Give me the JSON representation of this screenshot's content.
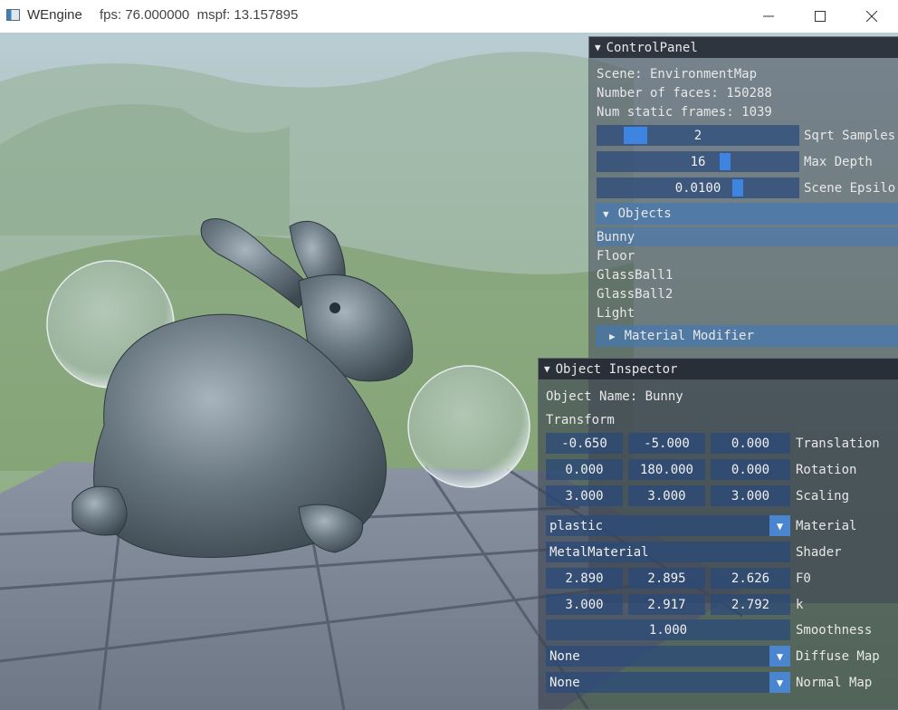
{
  "window": {
    "title": "WEngine",
    "stats": "fps: 76.000000  mspf: 13.157895",
    "minimize": "—",
    "maximize": "☐",
    "close": "✕"
  },
  "colors": {
    "accent": "#3d85e0",
    "frame_bg": "#294a7a",
    "header": "#4278b9"
  },
  "control_panel": {
    "title": "ControlPanel",
    "scene": "Scene: EnvironmentMap",
    "faces": "Number of faces: 150288",
    "static_frames": "Num static frames: 1039",
    "sqrt_samples": {
      "value": "2",
      "label": "Sqrt Samples"
    },
    "max_depth": {
      "value": "16",
      "label": "Max Depth"
    },
    "scene_epsilon": {
      "value": "0.0100",
      "label": "Scene Epsilo"
    },
    "objects_header": "Objects",
    "objects": [
      "Bunny",
      "Floor",
      "GlassBall1",
      "GlassBall2",
      "Light"
    ],
    "selected_object": "Bunny",
    "material_modifier": "Material Modifier"
  },
  "object_inspector": {
    "title": "Object Inspector",
    "object_name": "Object Name: Bunny",
    "transform_label": "Transform",
    "translation": {
      "values": [
        "-0.650",
        "-5.000",
        "0.000"
      ],
      "label": "Translation"
    },
    "rotation": {
      "values": [
        "0.000",
        "180.000",
        "0.000"
      ],
      "label": "Rotation"
    },
    "scaling": {
      "values": [
        "3.000",
        "3.000",
        "3.000"
      ],
      "label": "Scaling"
    },
    "material": {
      "value": "plastic",
      "label": "Material"
    },
    "shader": {
      "value": "MetalMaterial",
      "label": "Shader"
    },
    "f0": {
      "values": [
        "2.890",
        "2.895",
        "2.626"
      ],
      "label": "F0"
    },
    "k": {
      "values": [
        "3.000",
        "2.917",
        "2.792"
      ],
      "label": "k"
    },
    "smoothness": {
      "value": "1.000",
      "label": "Smoothness"
    },
    "diffuse_map": {
      "value": "None",
      "label": "Diffuse Map"
    },
    "normal_map": {
      "value": "None",
      "label": "Normal Map"
    }
  }
}
